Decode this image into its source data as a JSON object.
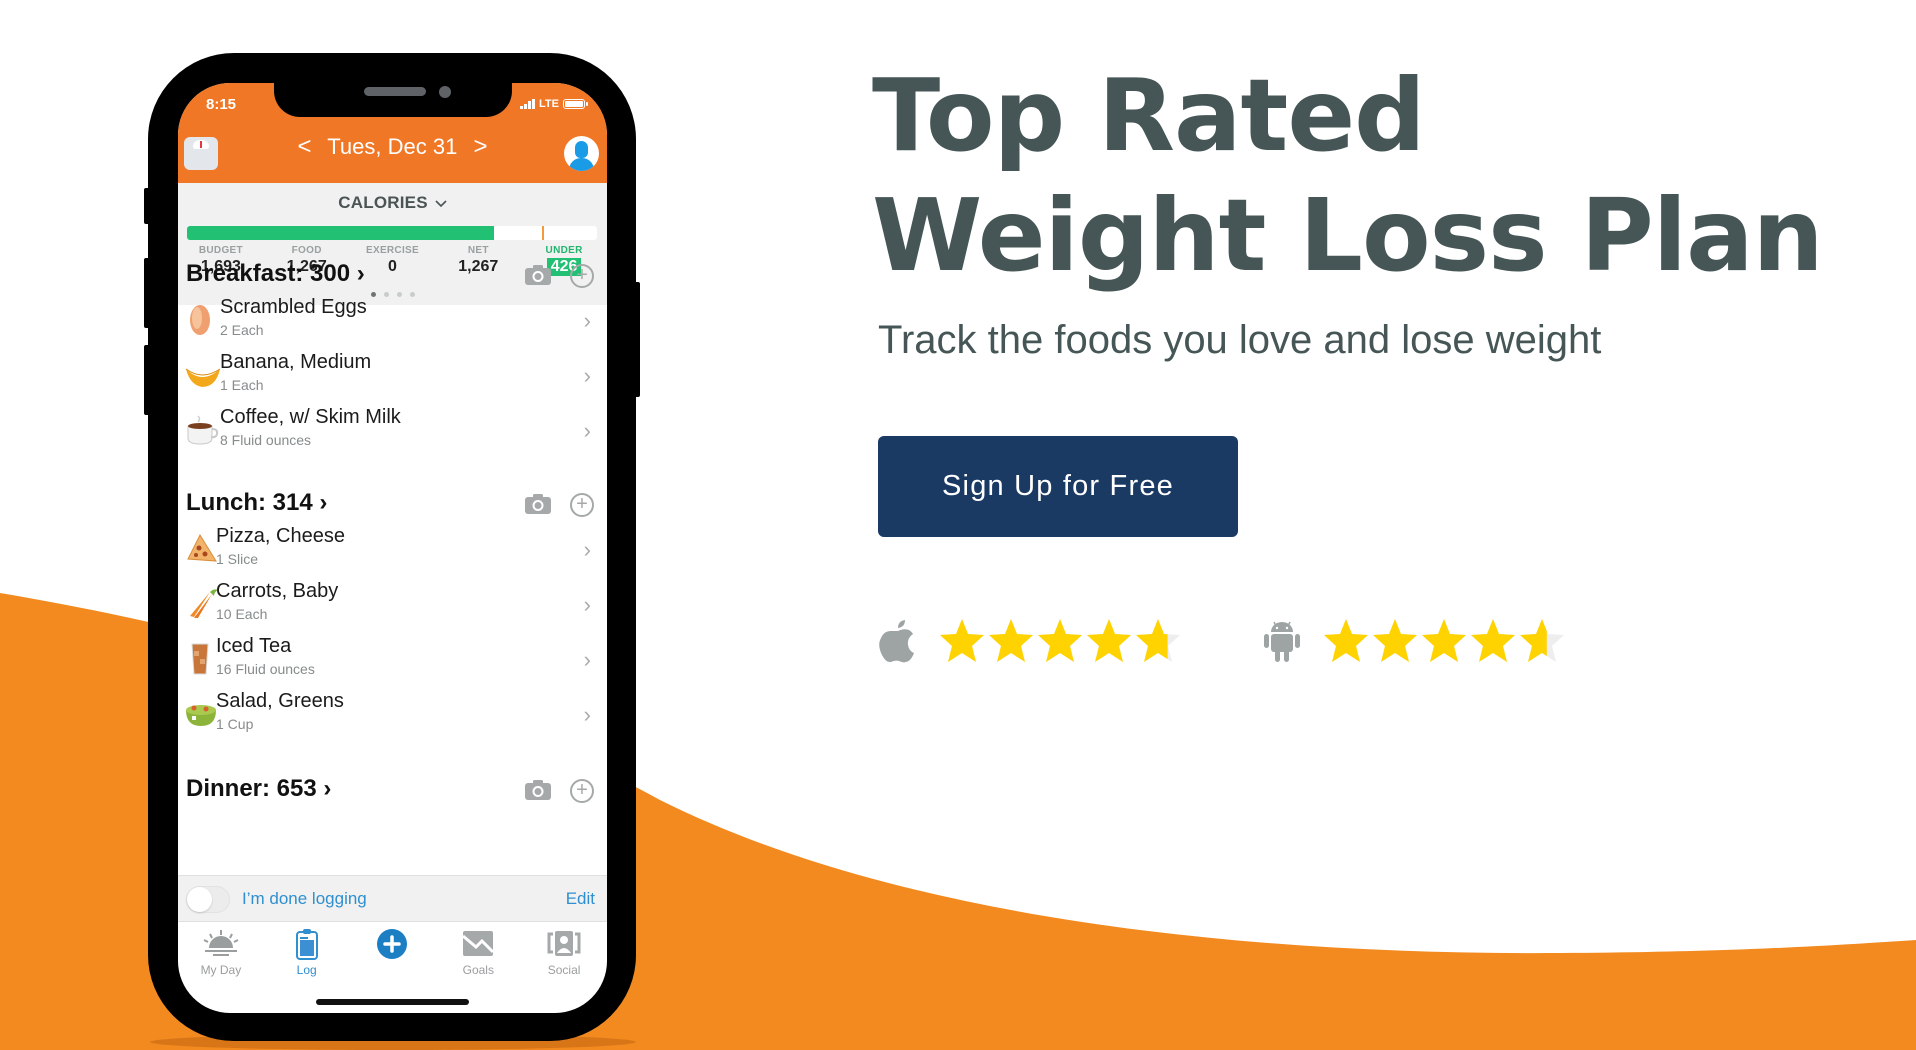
{
  "hero": {
    "headline_line1": "Top Rated",
    "headline_line2": "Weight Loss Plan",
    "subheadline": "Track the foods you love and lose weight",
    "cta_label": "Sign Up for Free"
  },
  "ratings": [
    {
      "platform": "apple",
      "icon": "apple-icon",
      "stars": 4.7,
      "max": 5
    },
    {
      "platform": "android",
      "icon": "android-icon",
      "stars": 4.6,
      "max": 5
    }
  ],
  "colors": {
    "brand_orange": "#f28a1f",
    "app_orange": "#f07725",
    "headline": "#465656",
    "cta": "#1b3a63",
    "star": "#ffd300",
    "progress_green": "#22c073",
    "link_blue": "#2f8fd0"
  },
  "phone": {
    "status": {
      "time": "8:15",
      "network": "LTE"
    },
    "header": {
      "date": "Tues, Dec 31",
      "prev": "<",
      "next": ">",
      "left_icon": "scale-icon",
      "right_icon": "avatar-icon"
    },
    "summary": {
      "title": "CALORIES",
      "progress_fraction": 0.748,
      "budget_marker_fraction": 0.865,
      "stats": [
        {
          "label": "BUDGET",
          "value": "1,693"
        },
        {
          "label": "FOOD",
          "value": "1,267"
        },
        {
          "label": "EXERCISE",
          "value": "0"
        },
        {
          "label": "NET",
          "value": "1,267"
        },
        {
          "label": "UNDER",
          "value": "426"
        }
      ],
      "page_dots": 4,
      "active_dot": 0
    },
    "meals": [
      {
        "title": "Breakfast: 300",
        "items": [
          {
            "name": "Scrambled Eggs",
            "qty": "2 Each",
            "icon": "egg-icon"
          },
          {
            "name": "Banana, Medium",
            "qty": "1 Each",
            "icon": "banana-icon"
          },
          {
            "name": "Coffee, w/ Skim Milk",
            "qty": "8 Fluid ounces",
            "icon": "coffee-icon"
          }
        ]
      },
      {
        "title": "Lunch: 314",
        "items": [
          {
            "name": "Pizza, Cheese",
            "qty": "1 Slice",
            "icon": "pizza-icon"
          },
          {
            "name": "Carrots, Baby",
            "qty": "10 Each",
            "icon": "carrot-icon"
          },
          {
            "name": "Iced Tea",
            "qty": "16 Fluid ounces",
            "icon": "iced-tea-icon"
          },
          {
            "name": "Salad, Greens",
            "qty": "1 Cup",
            "icon": "salad-icon"
          }
        ]
      },
      {
        "title": "Dinner: 653",
        "items": []
      }
    ],
    "done_logging": {
      "label": "I’m done logging",
      "edit": "Edit",
      "toggled": false
    },
    "tabs": [
      {
        "label": "My Day",
        "icon": "sunrise-icon",
        "active": false
      },
      {
        "label": "Log",
        "icon": "clipboard-icon",
        "active": true
      },
      {
        "label": "",
        "icon": "add-circle-icon",
        "active": false
      },
      {
        "label": "Goals",
        "icon": "goals-chart-icon",
        "active": false
      },
      {
        "label": "Social",
        "icon": "social-icon",
        "active": false
      }
    ]
  }
}
